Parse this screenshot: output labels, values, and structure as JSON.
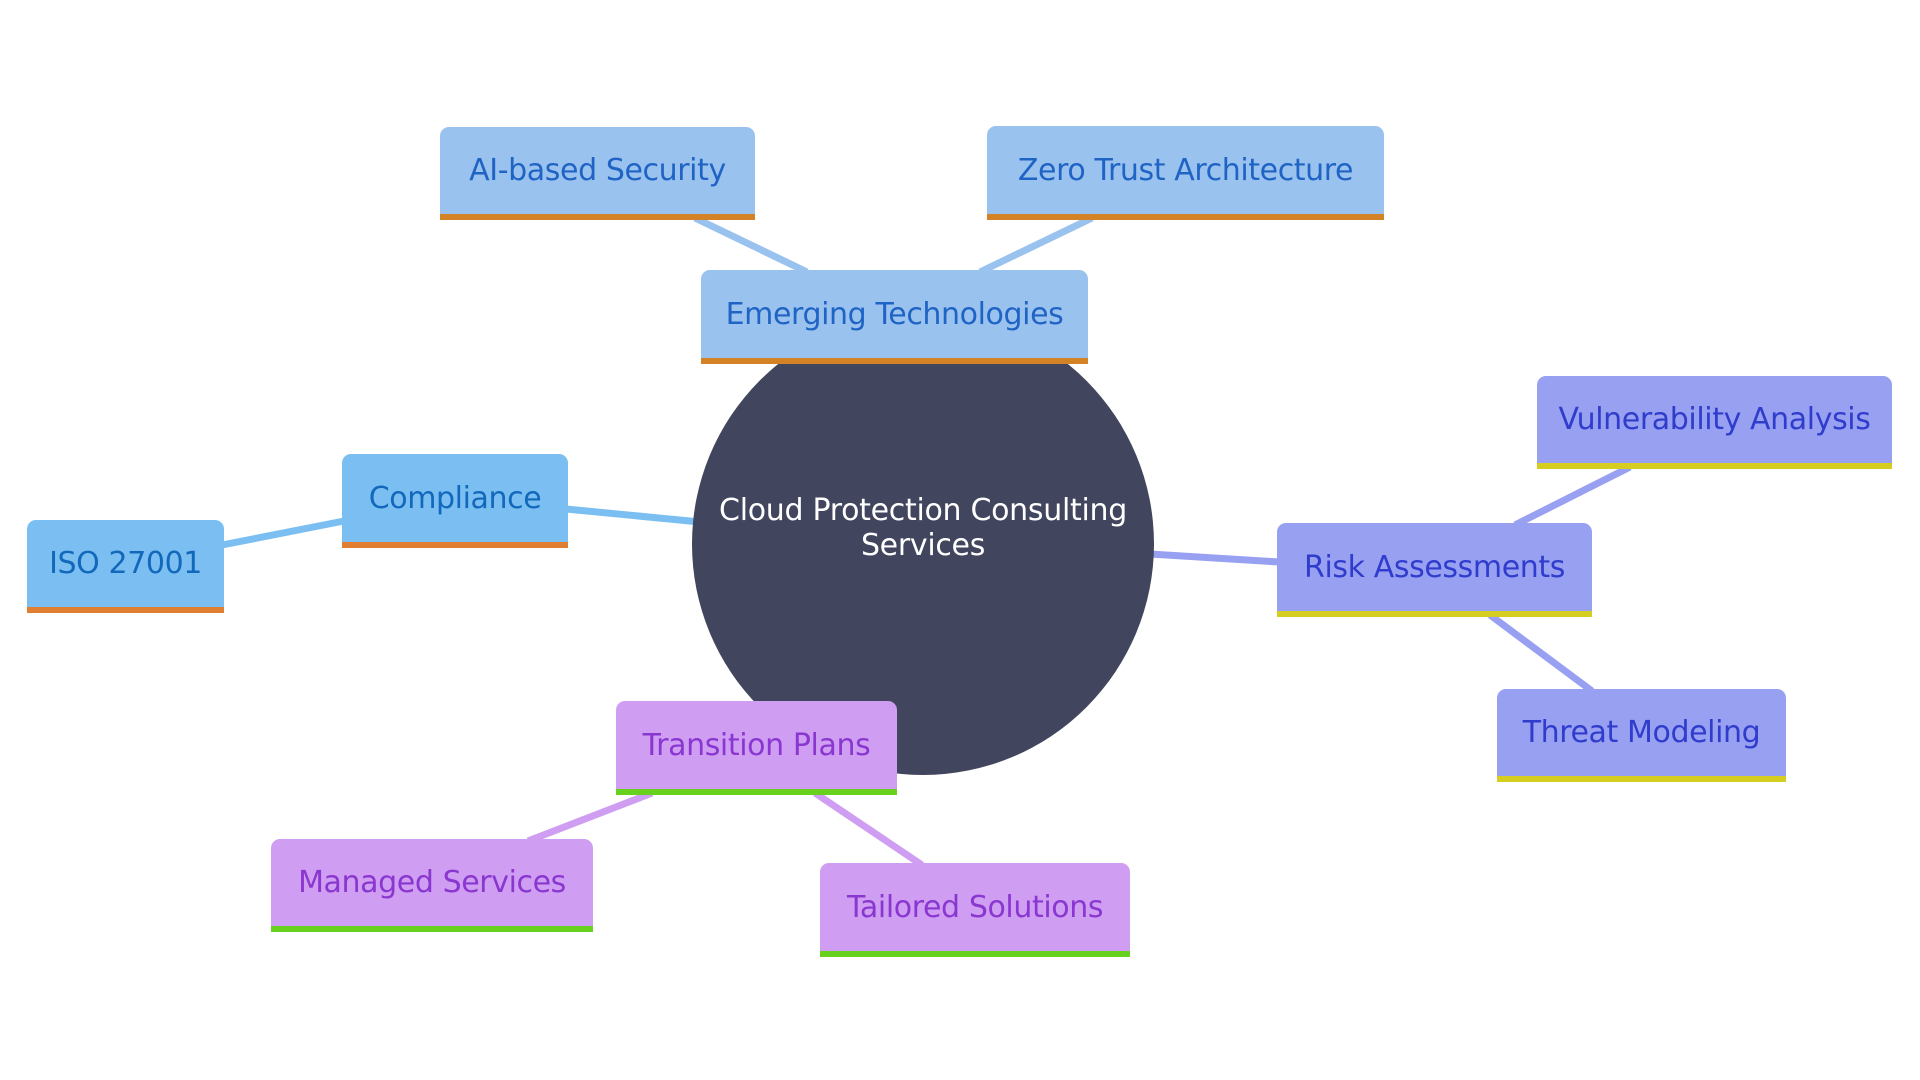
{
  "diagram": {
    "type": "mindmap",
    "root": {
      "label": "Cloud Protection Consulting Services",
      "color": "#41455d"
    },
    "branches": [
      {
        "label": "Emerging Technologies",
        "fill": "#9ac2ef",
        "text_color": "#1f64c4",
        "accent": "#d48226",
        "children": [
          {
            "label": "AI-based Security"
          },
          {
            "label": "Zero Trust Architecture"
          }
        ]
      },
      {
        "label": "Compliance",
        "fill": "#7bbff2",
        "text_color": "#1268bb",
        "accent": "#e07f31",
        "children": [
          {
            "label": "ISO 27001"
          }
        ]
      },
      {
        "label": "Risk Assessments",
        "fill": "#98a0f2",
        "text_color": "#2f3ccc",
        "accent": "#d6cd21",
        "children": [
          {
            "label": "Vulnerability Analysis"
          },
          {
            "label": "Threat Modeling"
          }
        ]
      },
      {
        "label": "Transition Plans",
        "fill": "#cf9ef2",
        "text_color": "#8a36d0",
        "accent": "#68d11d",
        "children": [
          {
            "label": "Managed Services"
          },
          {
            "label": "Tailored Solutions"
          }
        ]
      }
    ]
  }
}
